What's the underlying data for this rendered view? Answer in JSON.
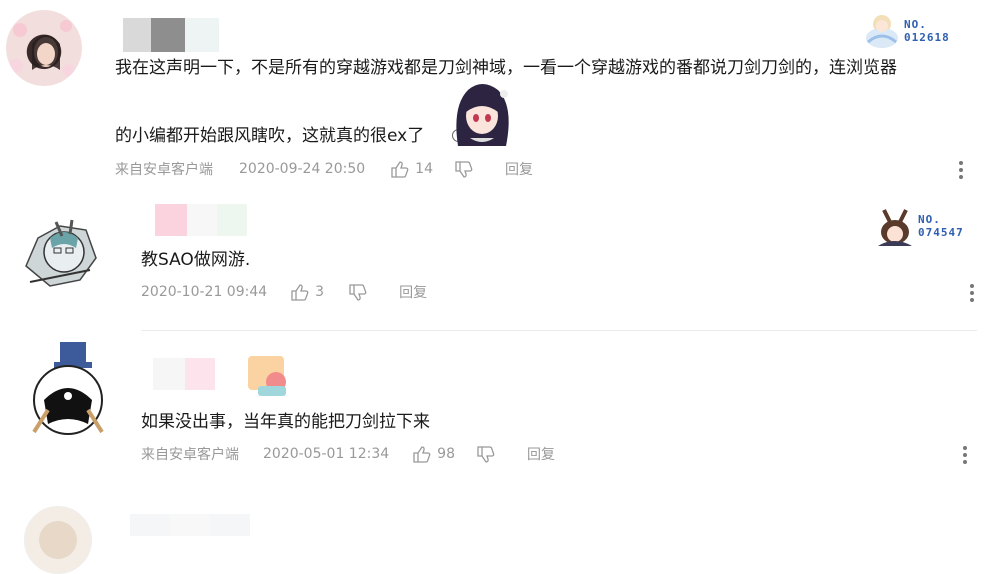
{
  "comments": [
    {
      "text_line1": "我在这声明一下，不是所有的穿越游戏都是刀剑神域，一看一个穿越游戏的番都说刀剑刀剑的，连浏览器",
      "text_line2": "的小编都开始跟风瞎吹，这就真的很ex了",
      "source": "来自安卓客户端",
      "time": "2020-09-24 20:50",
      "likes": "14",
      "reply_label": "回复",
      "badge_no": "NO.",
      "badge_num": "012618"
    },
    {
      "text_line1": "教SAO做网游.",
      "time": "2020-10-21 09:44",
      "likes": "3",
      "reply_label": "回复",
      "badge_no": "NO.",
      "badge_num": "074547"
    },
    {
      "text_line1": "如果没出事，当年真的能把刀剑拉下来",
      "source": "来自安卓客户端",
      "time": "2020-05-01 12:34",
      "likes": "98",
      "reply_label": "回复"
    }
  ],
  "colors": {
    "meta_gray": "#999999",
    "badge_blue": "#2f5fb0",
    "divider": "#ececec"
  },
  "icons": [
    "thumb-up-icon",
    "thumb-down-icon",
    "more-vertical-icon",
    "avatar",
    "fan-badge-icon",
    "sticker-icon"
  ]
}
